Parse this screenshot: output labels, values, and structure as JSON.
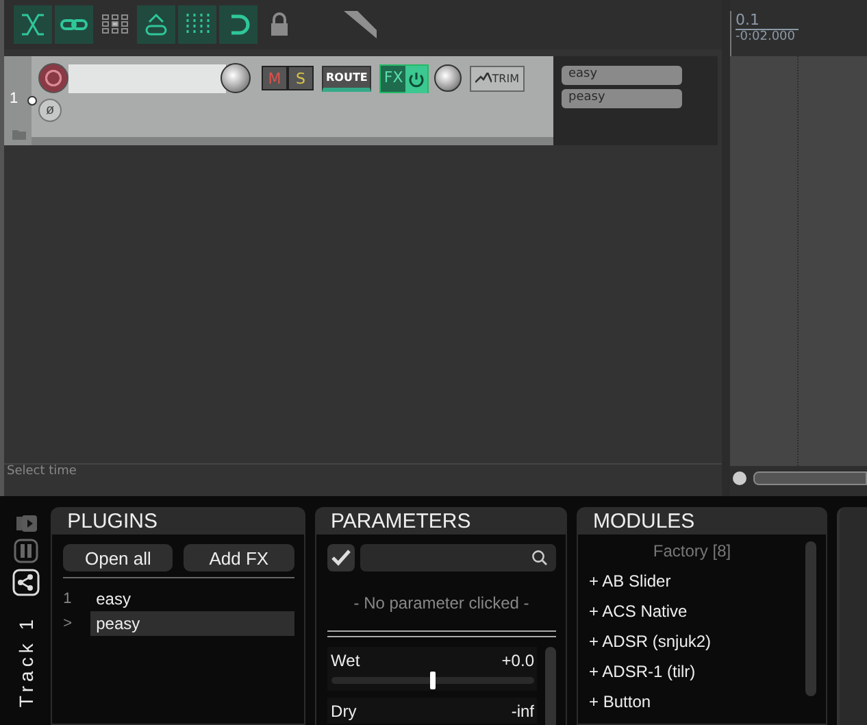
{
  "toolbar": {
    "buttons": [
      {
        "kind": "crossfade",
        "on": true
      },
      {
        "kind": "link",
        "on": true
      },
      {
        "kind": "grid",
        "on": false
      },
      {
        "kind": "envelope-link",
        "on": true
      },
      {
        "kind": "snap",
        "on": true
      },
      {
        "kind": "loop",
        "on": true
      },
      {
        "kind": "lock",
        "on": false
      }
    ]
  },
  "track": {
    "number": "1",
    "armed": false,
    "mute_label": "M",
    "solo_label": "S",
    "route_label": "ROUTE",
    "fx_label": "FX",
    "fx_on": true,
    "trim_label": "TRIM",
    "phase_label": "ø",
    "fx_chain": [
      "easy",
      "peasy"
    ]
  },
  "ruler": {
    "bar": "0.1",
    "time": "-0:02.000"
  },
  "status_bar": "Select time",
  "side_panel": {
    "track_label": "Track 1"
  },
  "plugins": {
    "title": "PLUGINS",
    "buttons": [
      "Open all",
      "Add FX"
    ],
    "items": [
      {
        "index": "1",
        "name": "easy",
        "selected": false
      },
      {
        "index": ">",
        "name": "peasy",
        "selected": true
      }
    ]
  },
  "parameters": {
    "title": "PARAMETERS",
    "filter_checked": true,
    "message": "- No parameter clicked -",
    "items": [
      {
        "name": "Wet",
        "value": "+0.0",
        "level": 0.5
      },
      {
        "name": "Dry",
        "value": "-inf"
      }
    ]
  },
  "modules": {
    "title": "MODULES",
    "group": "Factory [8]",
    "items": [
      "+ AB Slider",
      "+ ACS Native",
      "+ ADSR (snjuk2)",
      "+ ADSR-1 (tilr)",
      "+ Button"
    ]
  }
}
